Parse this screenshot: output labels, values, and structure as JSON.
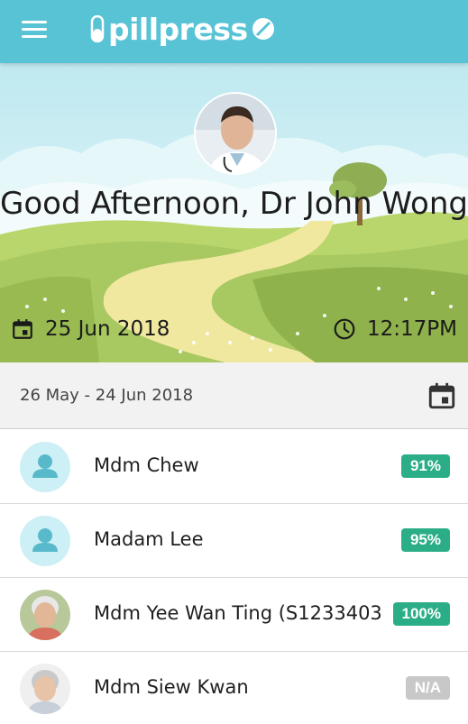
{
  "app": {
    "name": "pillpress",
    "brand_color": "#57c3d4"
  },
  "hero": {
    "greeting": "Good Afternoon, Dr John Wong",
    "date": "25 Jun 2018",
    "time": "12:17PM"
  },
  "range": {
    "label": "26 May - 24 Jun 2018"
  },
  "patients": [
    {
      "name": "Mdm Chew",
      "compliance": "91%",
      "avatar": "placeholder-person-icon",
      "status_color": "#2bae87"
    },
    {
      "name": "Madam Lee",
      "compliance": "95%",
      "avatar": "placeholder-person-icon",
      "status_color": "#2bae87"
    },
    {
      "name": "Mdm Yee Wan Ting (S1233403",
      "compliance": "100%",
      "avatar": "photo",
      "status_color": "#2bae87"
    },
    {
      "name": "Mdm Siew Kwan",
      "compliance": "N/A",
      "avatar": "photo",
      "status_color": "#c8c8c8"
    }
  ]
}
